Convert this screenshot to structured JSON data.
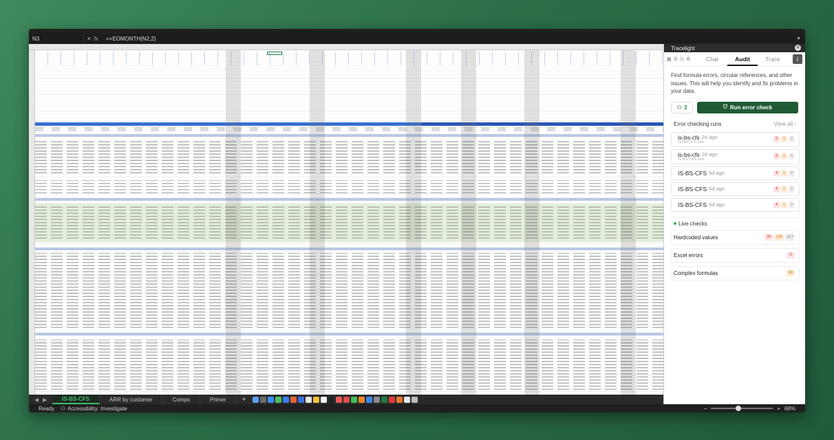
{
  "formula_bar": {
    "name_box": "N3",
    "fx": "fx",
    "formula": "=+EOMONTH(N2,2)"
  },
  "sheet_tabs": [
    "IS-BS-CFS",
    "ARR by customer",
    "Comps",
    "Primer"
  ],
  "status": {
    "ready": "Ready",
    "accessibility": "Accessibility: Investigate",
    "zoom": "68%"
  },
  "panel": {
    "title": "Tracelight",
    "tabs": [
      "Chat",
      "Audit",
      "Trace"
    ],
    "active_tab": "Audit",
    "intro": "Find formula errors, circular references, and other issues. This will help you identify and fix problems in your data.",
    "user_count": "3",
    "run_button": "Run error check",
    "runs_header": "Error checking runs",
    "view_all": "View all",
    "runs": [
      {
        "name": "is-bs-cfs",
        "ago": "2d ago",
        "file": "IS-BS-CFS.xlsx",
        "b1": "5",
        "b2": "1",
        "b3": "0"
      },
      {
        "name": "is-bs-cfs",
        "ago": "2d ago",
        "file": "IS-BS-CFS.xlsx",
        "b1": "5",
        "b2": "1",
        "b3": "0"
      },
      {
        "name": "IS-BS-CFS",
        "ago": "6d ago",
        "file": "",
        "b1": "4",
        "b2": "1",
        "b3": "0"
      },
      {
        "name": "IS-BS-CFS",
        "ago": "6d ago",
        "file": "",
        "b1": "4",
        "b2": "1",
        "b3": "0"
      },
      {
        "name": "IS-BS-CFS",
        "ago": "6d ago",
        "file": "",
        "b1": "4",
        "b2": "1",
        "b3": "0"
      }
    ],
    "live_header": "Live checks",
    "live": [
      {
        "name": "Hardcoded values",
        "b1": "30",
        "b2": "155",
        "b3": "117"
      },
      {
        "name": "Excel errors",
        "b1": "0"
      },
      {
        "name": "Complex formulas",
        "b1": "69"
      }
    ]
  }
}
